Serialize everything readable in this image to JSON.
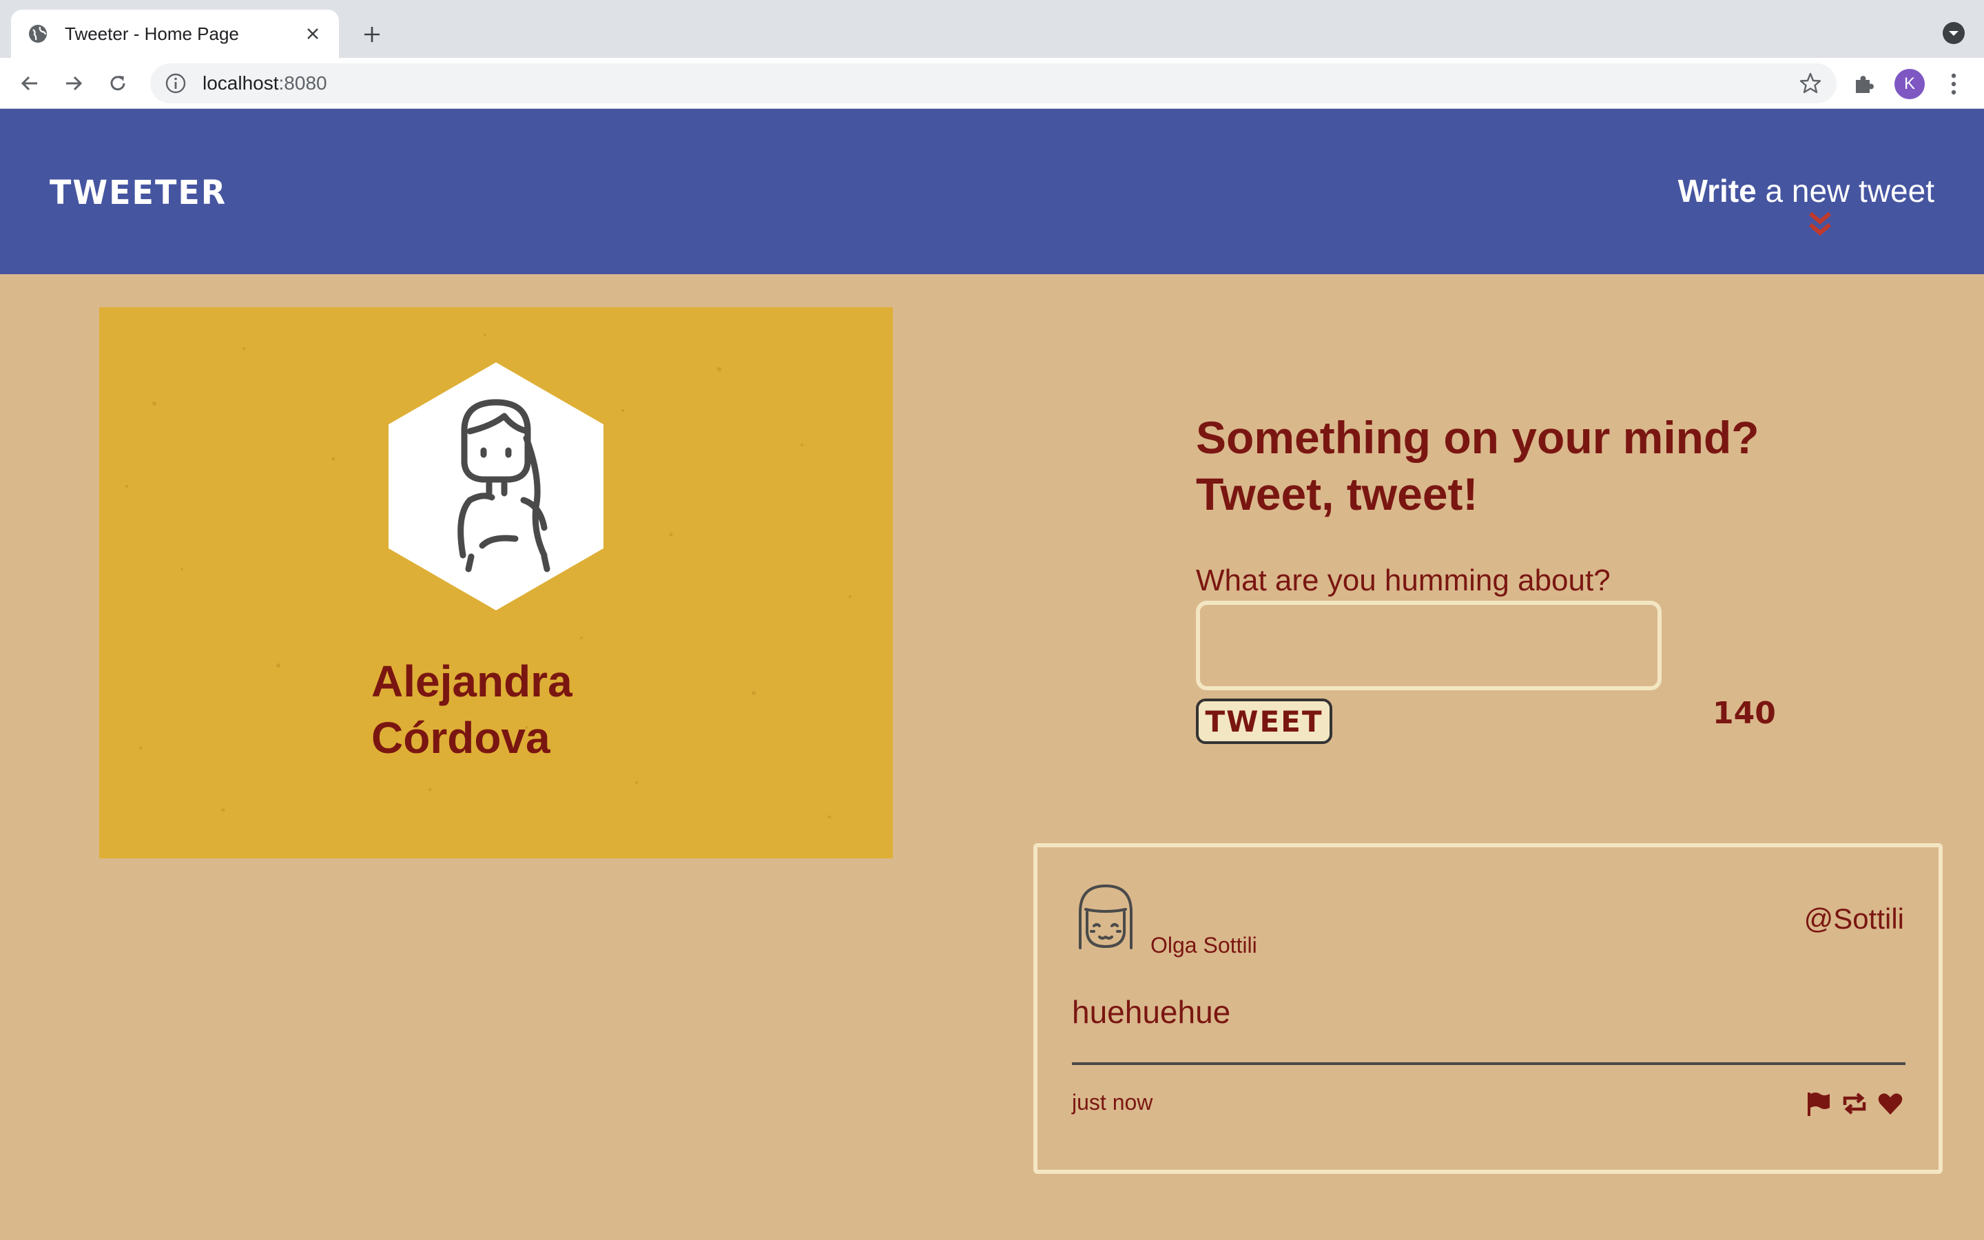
{
  "browser": {
    "tab_title": "Tweeter - Home Page",
    "url_host": "localhost",
    "url_port": ":8080",
    "profile_initial": "K"
  },
  "nav": {
    "brand": "TWEETER",
    "write_bold": "Write",
    "write_rest": " a new tweet"
  },
  "profile": {
    "name_first": "Alejandra",
    "name_last": "Córdova"
  },
  "compose": {
    "heading_line1": "Something on your mind?",
    "heading_line2": "Tweet, tweet!",
    "label": "What are you humming about?",
    "input_value": "",
    "button_label": "TWEET",
    "counter": "140"
  },
  "tweets": [
    {
      "author": "Olga Sottili",
      "handle": "@Sottili",
      "text": "huehuehue",
      "time": "just now"
    }
  ],
  "colors": {
    "page_bg": "#d9b88c",
    "nav_bg": "#4655a0",
    "card_bg": "#deaf36",
    "accent": "#7a1611",
    "border": "#f3e6c3",
    "chevron": "#c0392b"
  },
  "icons": [
    "globe-icon",
    "close-icon",
    "plus-icon",
    "chevron-down-icon",
    "back-icon",
    "forward-icon",
    "reload-icon",
    "info-icon",
    "star-icon",
    "puzzle-icon",
    "kebab-icon",
    "double-chevron-icon",
    "woman-avatar-icon",
    "girl-avatar-icon",
    "flag-icon",
    "retweet-icon",
    "heart-icon"
  ]
}
